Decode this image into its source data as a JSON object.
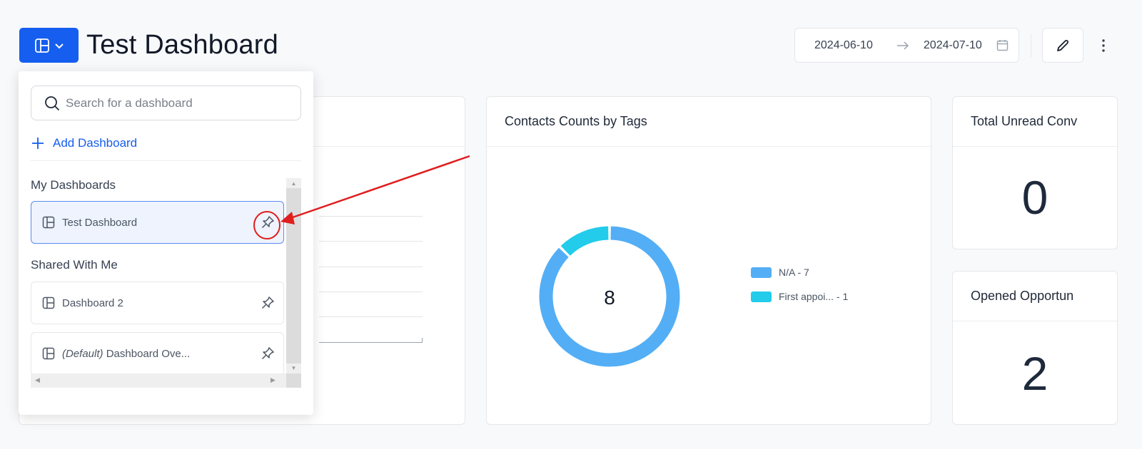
{
  "header": {
    "title": "Test Dashboard",
    "date_start": "2024-06-10",
    "date_end": "2024-07-10",
    "accent_color": "#155eef"
  },
  "icons": {
    "switcher": "layout-icon",
    "chevron": "chevron-down-icon",
    "arrow": "arrow-right-icon",
    "calendar": "calendar-icon",
    "edit": "pencil-icon",
    "more": "more-vertical-icon",
    "search": "search-icon",
    "add": "plus-icon",
    "pin": "pin-icon"
  },
  "dropdown": {
    "search_placeholder": "Search for a dashboard",
    "add_label": "Add Dashboard",
    "my_section": "My Dashboards",
    "shared_section": "Shared With Me",
    "my_items": [
      {
        "name": "Test Dashboard",
        "active": true
      }
    ],
    "shared_items": [
      {
        "name": "Dashboard 2"
      },
      {
        "prefix": "(Default)",
        "name": "Dashboard Ove..."
      }
    ]
  },
  "cards": {
    "tags": {
      "title": "Contacts Counts by Tags",
      "center_value": "8",
      "legend": [
        {
          "label": "N/A - 7",
          "color": "#53aef5"
        },
        {
          "label": "First appoi... - 1",
          "color": "#22ccea"
        }
      ]
    },
    "unread": {
      "title": "Total Unread Conv",
      "value": "0"
    },
    "opportunities": {
      "title": "Opened Opportun",
      "value": "2"
    }
  },
  "chart_data": {
    "type": "pie",
    "title": "Contacts Counts by Tags",
    "labels": [
      "N/A",
      "First appoi..."
    ],
    "values": [
      7,
      1
    ],
    "colors": [
      "#53aef5",
      "#22ccea"
    ],
    "donut": true,
    "center_label": "8",
    "legend_position": "right"
  }
}
